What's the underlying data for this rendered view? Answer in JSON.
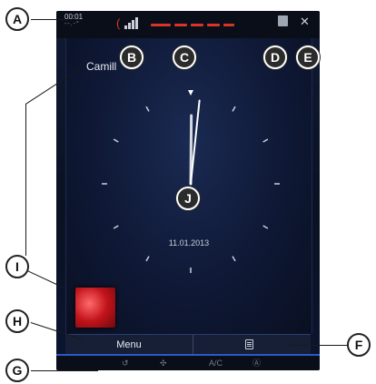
{
  "status_bar": {
    "time": "00:01",
    "time_sub": "--.-°"
  },
  "user": {
    "name": "Camill"
  },
  "clock": {
    "date": "11.01.2013",
    "hour": 12,
    "minute": 1
  },
  "bottom_bar": {
    "menu_label": "Menu"
  },
  "climate_bar": {
    "ac_label": "A/C",
    "auto_label": "Ⓐ"
  },
  "callouts": {
    "a": "A",
    "b": "B",
    "c": "C",
    "d": "D",
    "e": "E",
    "f": "F",
    "g": "G",
    "h": "H",
    "i": "I",
    "j": "J"
  },
  "colors": {
    "accent": "#d8352a",
    "screen_bg": "#0e1733",
    "climate_accent": "#2c59c9"
  },
  "icons": [
    "phone-icon",
    "signal-icon",
    "progress-icon",
    "note-icon",
    "close-icon",
    "list-icon",
    "recirculation-icon",
    "fan-icon"
  ]
}
